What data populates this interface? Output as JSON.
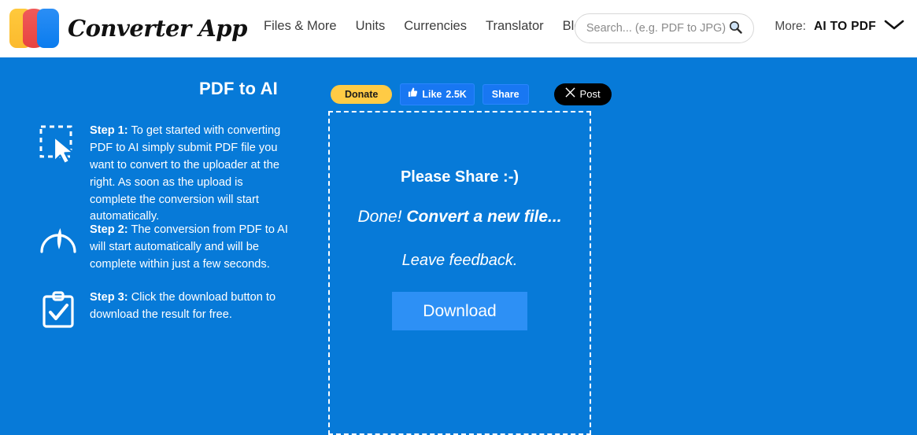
{
  "header": {
    "brand": "Converter App",
    "logo_icon": "converter-app-logo",
    "nav": [
      {
        "label": "Files & More"
      },
      {
        "label": "Units"
      },
      {
        "label": "Currencies"
      },
      {
        "label": "Translator"
      },
      {
        "label": "Blog"
      }
    ],
    "search": {
      "placeholder": "Search... (e.g. PDF to JPG)",
      "value": "",
      "icon": "search-icon"
    },
    "more": {
      "label": "More:",
      "value": "AI TO PDF",
      "icon": "chevron-down-icon"
    }
  },
  "main": {
    "title": "PDF to AI",
    "steps": [
      {
        "icon": "cursor-select-icon",
        "label": "Step 1:",
        "text": " To get started with converting PDF to AI simply submit PDF file you want to convert to the uploader at the right. As soon as the upload is complete the conversion will start automatically."
      },
      {
        "icon": "speedometer-icon",
        "label": "Step 2:",
        "text": " The conversion from PDF to AI will start automatically and will be complete within just a few seconds."
      },
      {
        "icon": "clipboard-check-icon",
        "label": "Step 3:",
        "text": " Click the download button to download the result for free."
      }
    ],
    "social": {
      "donate": "Donate",
      "like": "Like",
      "like_count": "2.5K",
      "like_icon": "thumbs-up-icon",
      "share": "Share",
      "post": "Post",
      "post_icon": "x-logo-icon"
    },
    "panel": {
      "share_heading": "Please Share :-)",
      "done_prefix": "Done! ",
      "done_link": "Convert a new file...",
      "feedback": "Leave feedback.",
      "download": "Download"
    }
  },
  "colors": {
    "page_background": "#077AD8",
    "header_background": "#FFFFFF",
    "download_button": "#2D90F5",
    "donate_button": "#FFCB45",
    "facebook_blue": "#1877F2",
    "x_black": "#000000"
  }
}
